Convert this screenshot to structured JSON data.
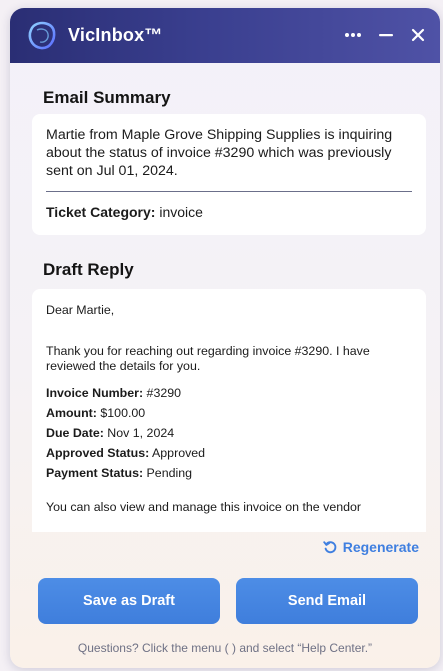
{
  "window": {
    "title": "VicInbox™",
    "controls": {
      "more_icon": "more-horizontal-icon",
      "minimize_icon": "minimize-icon",
      "close_icon": "close-icon"
    }
  },
  "summary": {
    "heading": "Email Summary",
    "text": "Martie from Maple Grove Shipping Supplies is inquiring about the status of invoice #3290 which was previously sent on Jul 01, 2024.",
    "category_label": "Ticket Category:",
    "category_value": "invoice"
  },
  "draft": {
    "heading": "Draft Reply",
    "greeting": "Dear Martie,",
    "intro": "Thank you for reaching out regarding invoice #3290. I have reviewed the details for you.",
    "details": [
      {
        "label": "Invoice Number:",
        "value": "#3290"
      },
      {
        "label": "Amount:",
        "value": "$100.00"
      },
      {
        "label": "Due Date:",
        "value": "Nov 1, 2024"
      },
      {
        "label": "Approved Status:",
        "value": "Approved"
      },
      {
        "label": "Payment Status:",
        "value": "Pending"
      }
    ],
    "closing": "You can also view and manage this invoice on the vendor"
  },
  "actions": {
    "regenerate_label": "Regenerate",
    "regenerate_icon": "regenerate-icon",
    "save_label": "Save as Draft",
    "send_label": "Send Email"
  },
  "help": {
    "text": "Questions? Click the menu (   ) and select “Help Center.”"
  },
  "colors": {
    "titlebar": "#2f337e",
    "accent": "#3f7edc",
    "link": "#3f7fe0"
  }
}
